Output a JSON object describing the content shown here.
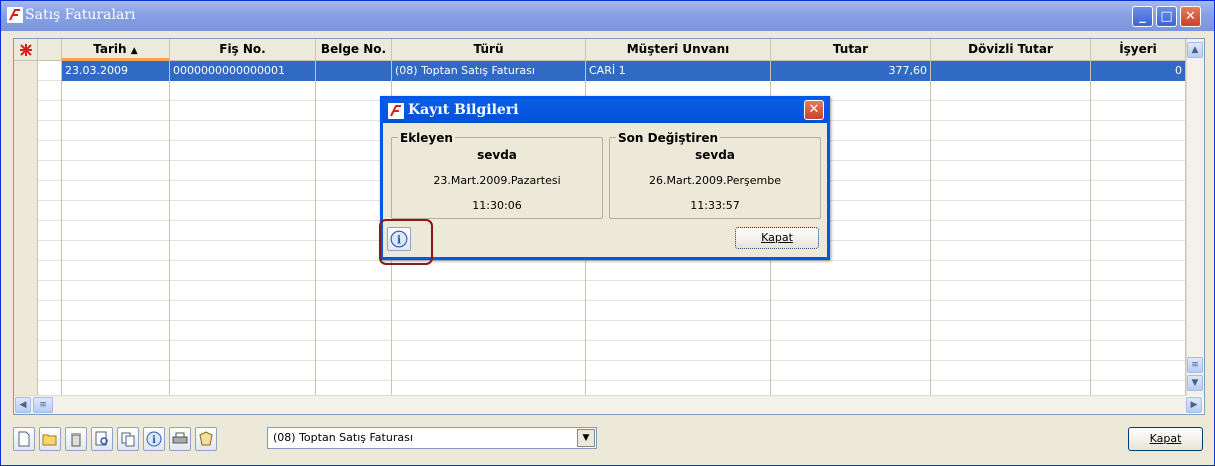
{
  "window": {
    "title": "Satış Faturaları"
  },
  "grid": {
    "columns": [
      "Tarih",
      "Fiş No.",
      "Belge No.",
      "Türü",
      "Müşteri Unvanı",
      "Tutar",
      "Dövizli Tutar",
      "İşyeri"
    ],
    "sorted_column": "Tarih",
    "rows": [
      {
        "tarih": "23.03.2009",
        "fis_no": "0000000000000001",
        "belge_no": "",
        "turu": "(08) Toptan Satış Faturası",
        "musteri": "CARİ 1",
        "tutar": "377,60",
        "dovizli": "",
        "isyeri": "0"
      }
    ]
  },
  "toolbar": {
    "filter_value": "(08) Toptan Satış Faturası",
    "close_label": "Kapat"
  },
  "dialog": {
    "title": "Kayıt Bilgileri",
    "ekleyen": {
      "legend": "Ekleyen",
      "user": "sevda",
      "date": "23.Mart.2009.Pazartesi",
      "time": "11:30:06"
    },
    "degistiren": {
      "legend": "Son Değiştiren",
      "user": "sevda",
      "date": "26.Mart.2009.Perşembe",
      "time": "11:33:57"
    },
    "close_label": "Kapat"
  },
  "colors": {
    "selection": "#316ac5",
    "titlebar": "#8aa3e6",
    "dialog_title": "#0058e6"
  }
}
